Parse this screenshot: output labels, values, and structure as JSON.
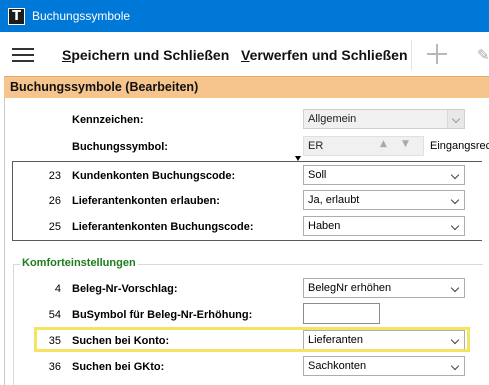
{
  "window": {
    "title": "Buchungssymbole",
    "app_icon": "T"
  },
  "toolbar": {
    "save_close_label": "Speichern und Schließen",
    "discard_close_label": "Verwerfen und Schließen"
  },
  "section": {
    "title": "Buchungssymbole (Bearbeiten)"
  },
  "fields": {
    "kennzeichen": {
      "label": "Kennzeichen:",
      "value": "Allgemein"
    },
    "buchungssymbol": {
      "label": "Buchungssymbol:",
      "value": "ER",
      "description": "Eingangsrec"
    }
  },
  "rows": [
    {
      "number": "23",
      "label": "Kundenkonten Buchungscode:",
      "value": "Soll"
    },
    {
      "number": "26",
      "label": "Lieferantenkonten erlauben:",
      "value": "Ja, erlaubt"
    },
    {
      "number": "25",
      "label": "Lieferantenkonten Buchungscode:",
      "value": "Haben"
    }
  ],
  "komfort": {
    "title": "Komforteinstellungen",
    "rows": [
      {
        "number": "4",
        "label": "Beleg-Nr-Vorschlag:",
        "value": "BelegNr erhöhen"
      },
      {
        "number": "54",
        "label": "BuSymbol für Beleg-Nr-Erhöhung:",
        "value": ""
      },
      {
        "number": "35",
        "label": "Suchen bei Konto:",
        "value": "Lieferanten"
      },
      {
        "number": "36",
        "label": "Suchen bei GKto:",
        "value": "Sachkonten"
      }
    ]
  },
  "icons": {
    "menu": "hamburger-menu-icon",
    "add": "plus-icon",
    "edit": "pencil-icon",
    "dropdown": "chevron-down-icon",
    "spin_up": "triangle-up-icon",
    "spin_down": "triangle-down-icon"
  },
  "colors": {
    "titlebar": "#0078d7",
    "section_header": "#f6c48d",
    "group_title": "#1d7c1d",
    "highlight": "#f4e461"
  }
}
